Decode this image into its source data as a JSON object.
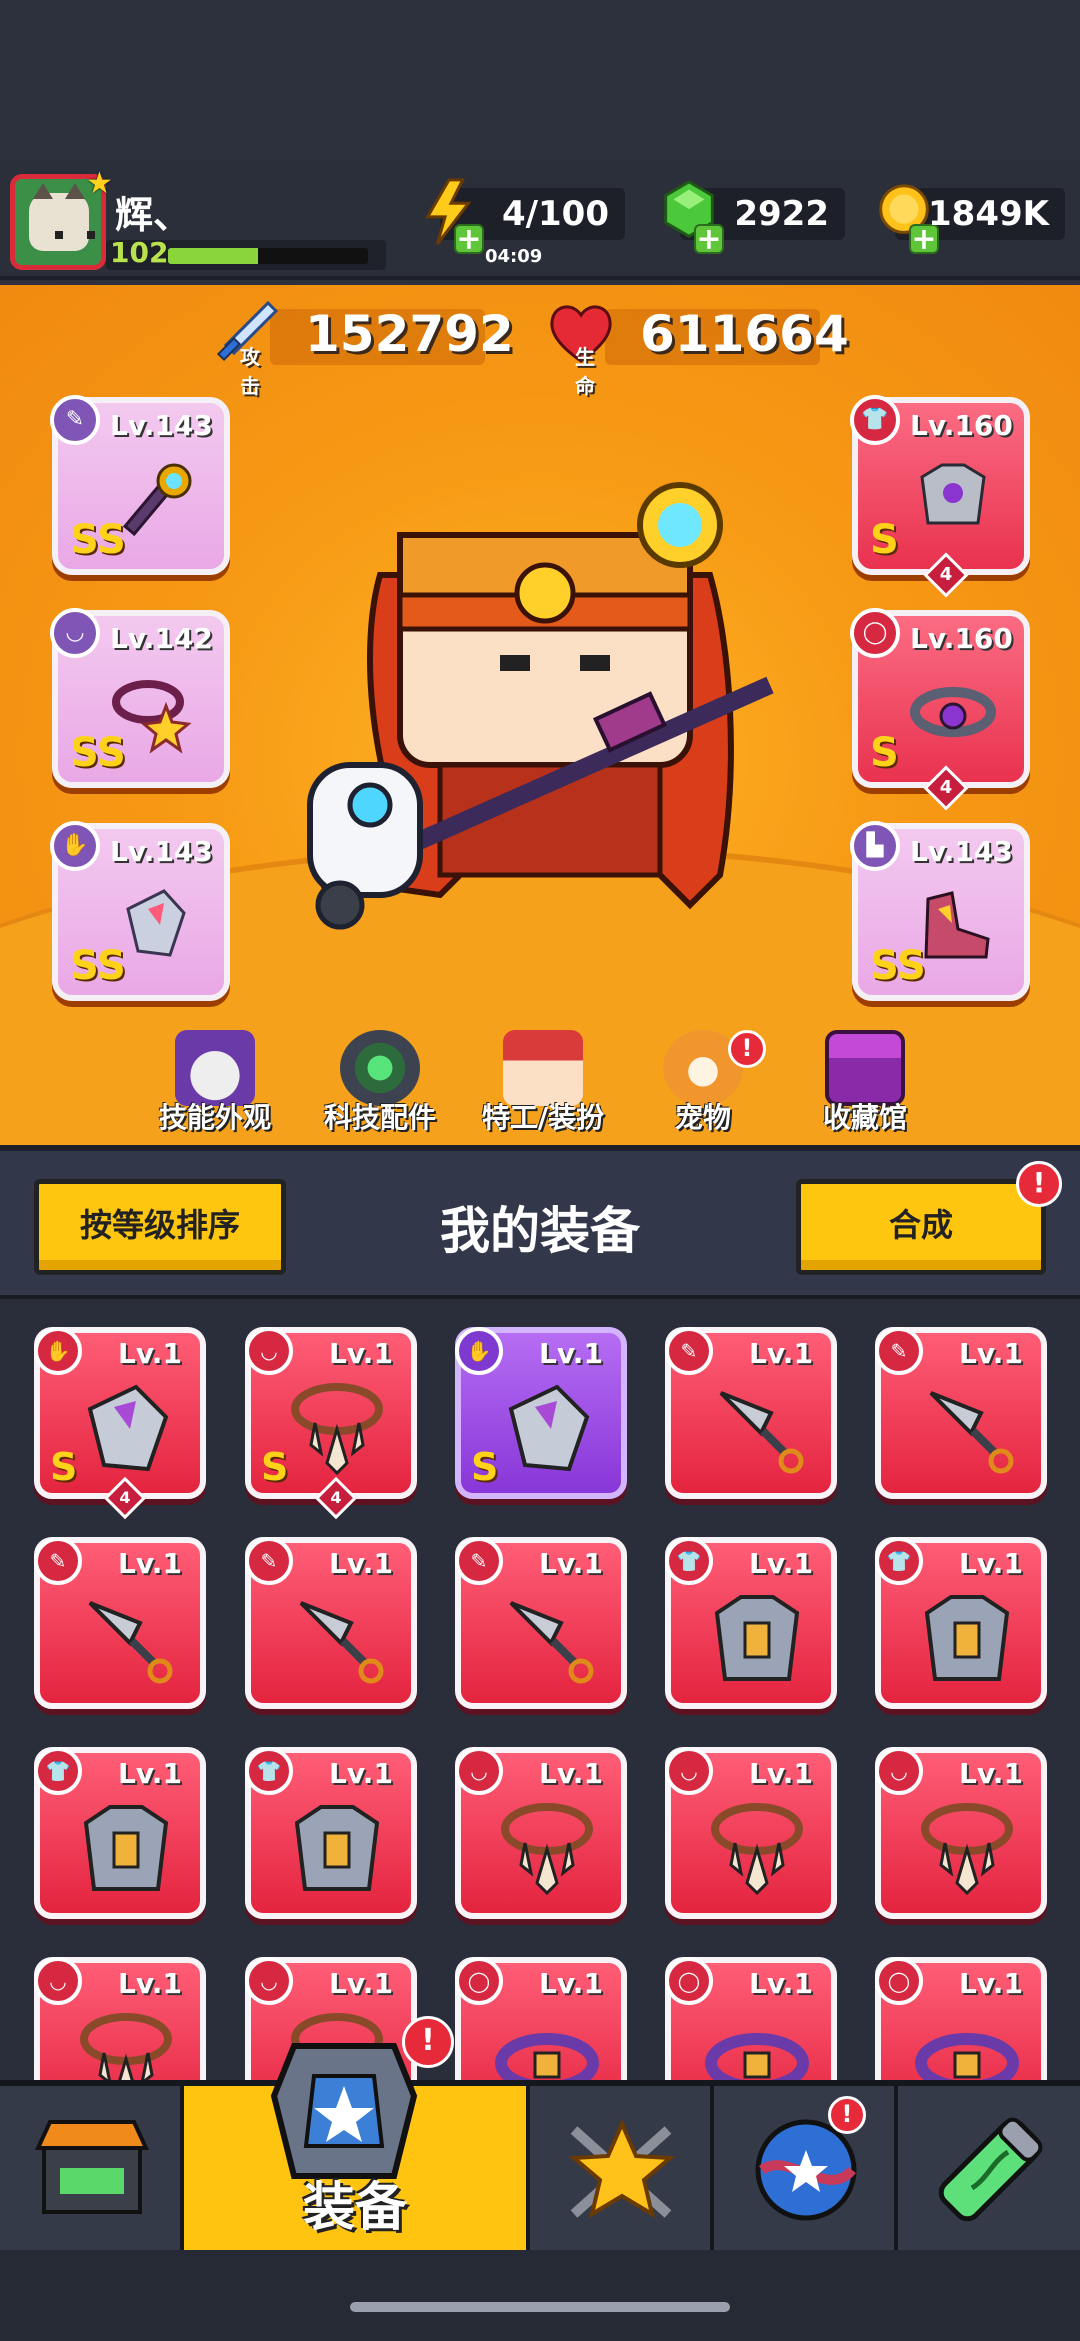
{
  "player": {
    "name": "辉、",
    "level": "102",
    "level_progress": 0.45
  },
  "resources": {
    "energy": "4/100",
    "energy_timer": "04:09",
    "gems": "2922",
    "gold": "1849K"
  },
  "stats": {
    "attack_value": "152792",
    "attack_label": "攻击",
    "hp_value": "611664",
    "hp_label": "生命"
  },
  "equipped": {
    "left": [
      {
        "level": "Lv.143",
        "rank": "SS",
        "slot": "weapon"
      },
      {
        "level": "Lv.142",
        "rank": "SS",
        "slot": "necklace"
      },
      {
        "level": "Lv.143",
        "rank": "SS",
        "slot": "gloves"
      }
    ],
    "right": [
      {
        "level": "Lv.160",
        "rank": "S",
        "stars": "4",
        "slot": "armor"
      },
      {
        "level": "Lv.160",
        "rank": "S",
        "stars": "4",
        "slot": "belt"
      },
      {
        "level": "Lv.143",
        "rank": "SS",
        "slot": "boots"
      }
    ]
  },
  "menu": [
    {
      "label": "技能外观",
      "icon": "skin-icon"
    },
    {
      "label": "科技配件",
      "icon": "tech-parts-icon"
    },
    {
      "label": "特工/装扮",
      "icon": "agent-costume-icon"
    },
    {
      "label": "宠物",
      "icon": "pet-icon",
      "alert": "!"
    },
    {
      "label": "收藏馆",
      "icon": "collection-icon"
    }
  ],
  "equipment_panel": {
    "sort_label": "按等级排序",
    "title": "我的装备",
    "merge_label": "合成",
    "merge_alert": "!"
  },
  "inventory": {
    "rows": [
      [
        {
          "level": "Lv.1",
          "slot": "gloves",
          "rank": "S",
          "stars": "4",
          "color": "red"
        },
        {
          "level": "Lv.1",
          "slot": "necklace",
          "rank": "S",
          "stars": "4",
          "color": "red"
        },
        {
          "level": "Lv.1",
          "slot": "gloves",
          "rank": "S",
          "color": "purple"
        },
        {
          "level": "Lv.1",
          "slot": "weapon",
          "color": "red"
        },
        {
          "level": "Lv.1",
          "slot": "weapon",
          "color": "red"
        }
      ],
      [
        {
          "level": "Lv.1",
          "slot": "weapon",
          "color": "red"
        },
        {
          "level": "Lv.1",
          "slot": "weapon",
          "color": "red"
        },
        {
          "level": "Lv.1",
          "slot": "weapon",
          "color": "red"
        },
        {
          "level": "Lv.1",
          "slot": "armor",
          "color": "red"
        },
        {
          "level": "Lv.1",
          "slot": "armor",
          "color": "red"
        }
      ],
      [
        {
          "level": "Lv.1",
          "slot": "armor",
          "color": "red"
        },
        {
          "level": "Lv.1",
          "slot": "armor",
          "color": "red"
        },
        {
          "level": "Lv.1",
          "slot": "necklace",
          "color": "red"
        },
        {
          "level": "Lv.1",
          "slot": "necklace",
          "color": "red"
        },
        {
          "level": "Lv.1",
          "slot": "necklace",
          "color": "red"
        }
      ],
      [
        {
          "level": "Lv.1",
          "slot": "necklace",
          "color": "red"
        },
        {
          "level": "Lv.1",
          "slot": "necklace",
          "color": "red"
        },
        {
          "level": "Lv.1",
          "slot": "belt",
          "color": "red"
        },
        {
          "level": "Lv.1",
          "slot": "belt",
          "color": "red"
        },
        {
          "level": "Lv.1",
          "slot": "belt",
          "color": "red"
        }
      ]
    ]
  },
  "bottom_nav": {
    "tabs": [
      {
        "icon": "shop-icon"
      },
      {
        "icon": "equipment-icon",
        "label": "装备",
        "active": true,
        "alert": "!"
      },
      {
        "icon": "talent-star-icon"
      },
      {
        "icon": "planet-icon",
        "alert": "!"
      },
      {
        "icon": "dna-capsule-icon"
      }
    ]
  },
  "colors": {
    "accent_yellow": "#ffc60f",
    "hero_orange": "#f79a15",
    "slot_red": "#e9324f",
    "slot_purple": "#8836d8"
  }
}
